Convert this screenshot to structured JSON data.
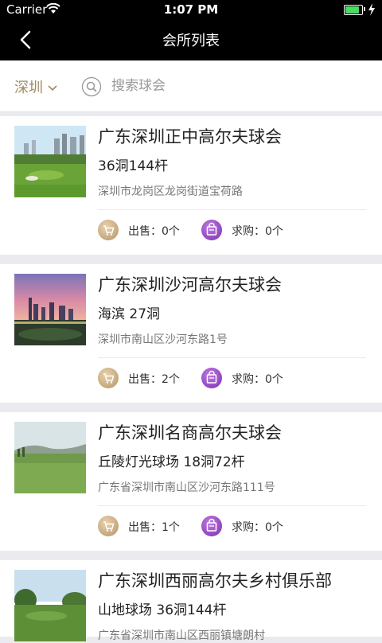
{
  "status": {
    "carrier": "Carrier",
    "time": "1:07 PM"
  },
  "nav": {
    "title": "会所列表"
  },
  "search": {
    "city": "深圳",
    "placeholder": "搜索球会"
  },
  "clubs": [
    {
      "name": "广东深圳正中高尔夫球会",
      "holes": "36洞144杆",
      "address": "深圳市龙岗区龙岗街道宝荷路",
      "sell": "出售：0个",
      "buy": "求购：0个"
    },
    {
      "name": "广东深圳沙河高尔夫球会",
      "holes": "海滨 27洞",
      "address": "深圳市南山区沙河东路1号",
      "sell": "出售：2个",
      "buy": "求购：0个"
    },
    {
      "name": "广东深圳名商高尔夫球会",
      "holes": "丘陵灯光球场 18洞72杆",
      "address": "广东省深圳市南山区沙河东路111号",
      "sell": "出售：1个",
      "buy": "求购：0个"
    },
    {
      "name": "广东深圳西丽高尔夫乡村俱乐部",
      "holes": "山地球场 36洞144杆",
      "address": "广东省深圳市南山区西丽镇塘朗村",
      "sell": "",
      "buy": ""
    }
  ]
}
